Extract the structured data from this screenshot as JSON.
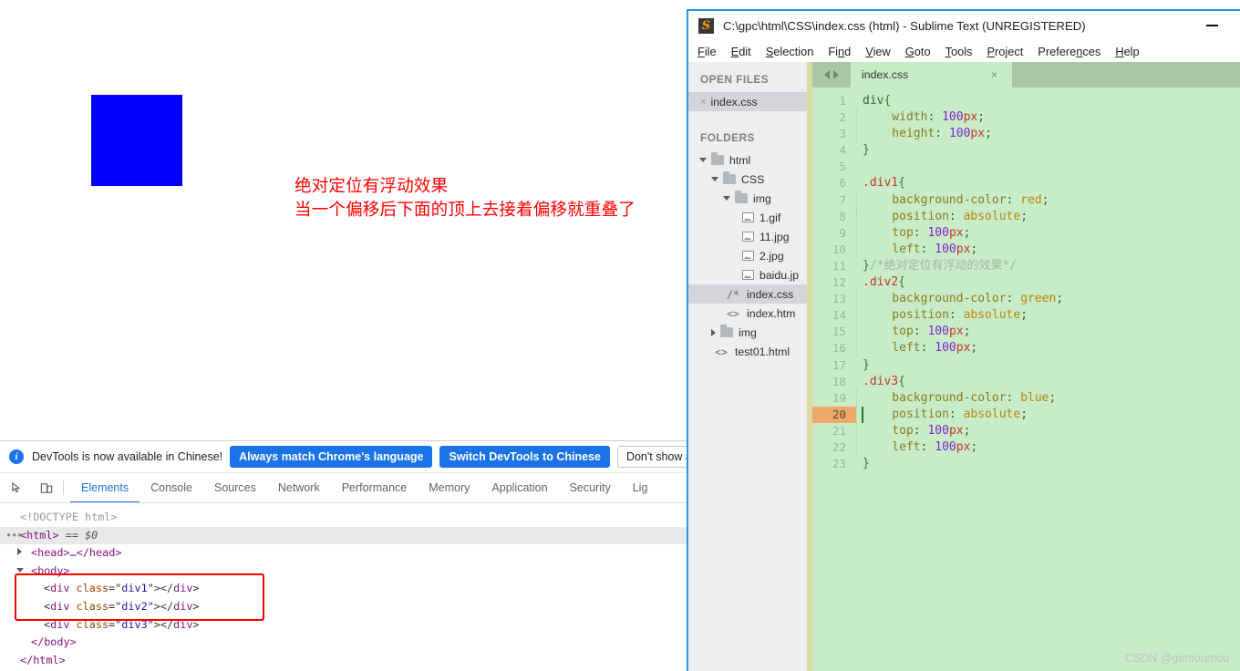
{
  "browser": {
    "blue_box_color": "#0000ff",
    "annotation": {
      "color": "#ff0000",
      "line1": "绝对定位有浮动效果",
      "line2": "当一个偏移后下面的顶上去接着偏移就重叠了"
    }
  },
  "devtools": {
    "notice": {
      "icon": "info-icon",
      "text": "DevTools is now available in Chinese!",
      "btn_always": "Always match Chrome's language",
      "btn_switch": "Switch DevTools to Chinese",
      "btn_dismiss": "Don't show again"
    },
    "toolbar": {
      "inspect_icon": "inspect-cursor-icon",
      "device_icon": "device-toolbar-icon"
    },
    "tabs": [
      {
        "label": "Elements",
        "active": true
      },
      {
        "label": "Console",
        "active": false
      },
      {
        "label": "Sources",
        "active": false
      },
      {
        "label": "Network",
        "active": false
      },
      {
        "label": "Performance",
        "active": false
      },
      {
        "label": "Memory",
        "active": false
      },
      {
        "label": "Application",
        "active": false
      },
      {
        "label": "Security",
        "active": false
      },
      {
        "label": "Lig",
        "active": false
      }
    ],
    "dom": {
      "doctype": "<!DOCTYPE html>",
      "html_open_tag": "<html>",
      "selected_marker": "== $0",
      "head_line": "<head>…</head>",
      "body_open": "<body>",
      "div1": {
        "tag": "div",
        "attr": "class",
        "value": "div1"
      },
      "div2": {
        "tag": "div",
        "attr": "class",
        "value": "div2"
      },
      "div3": {
        "tag": "div",
        "attr": "class",
        "value": "div3"
      },
      "body_close": "</body>",
      "html_close": "</html>",
      "highlight_color": "#ff0000"
    }
  },
  "sublime": {
    "titlebar": {
      "logo": "sublime-text-logo",
      "title": "C:\\gpc\\html\\CSS\\index.css (html) - Sublime Text (UNREGISTERED)",
      "minimize": "minimize-icon"
    },
    "menu": [
      {
        "label": "File",
        "mnemonic": "F"
      },
      {
        "label": "Edit",
        "mnemonic": "E"
      },
      {
        "label": "Selection",
        "mnemonic": "S"
      },
      {
        "label": "Find",
        "mnemonic": "n"
      },
      {
        "label": "View",
        "mnemonic": "V"
      },
      {
        "label": "Goto",
        "mnemonic": "G"
      },
      {
        "label": "Tools",
        "mnemonic": "T"
      },
      {
        "label": "Project",
        "mnemonic": "P"
      },
      {
        "label": "Preferences",
        "mnemonic": "n"
      },
      {
        "label": "Help",
        "mnemonic": "H"
      }
    ],
    "sidebar": {
      "open_files_heading": "OPEN FILES",
      "open_files": [
        {
          "label": "index.css",
          "selected": true
        }
      ],
      "folders_heading": "FOLDERS",
      "tree": [
        {
          "label": "html",
          "depth": 0,
          "icon": "folder-open-icon",
          "twisty": "down",
          "selected": false
        },
        {
          "label": "CSS",
          "depth": 1,
          "icon": "folder-open-icon",
          "twisty": "down",
          "selected": false
        },
        {
          "label": "img",
          "depth": 2,
          "icon": "folder-open-icon",
          "twisty": "down",
          "selected": false
        },
        {
          "label": "1.gif",
          "depth": 3,
          "icon": "image-file-icon",
          "twisty": "none",
          "selected": false
        },
        {
          "label": "11.jpg",
          "depth": 3,
          "icon": "image-file-icon",
          "twisty": "none",
          "selected": false
        },
        {
          "label": "2.jpg",
          "depth": 3,
          "icon": "image-file-icon",
          "twisty": "none",
          "selected": false
        },
        {
          "label": "baidu.jp",
          "depth": 3,
          "icon": "image-file-icon",
          "twisty": "none",
          "selected": false
        },
        {
          "label": "index.css",
          "depth": 2,
          "icon": "css-file-icon",
          "twisty": "none",
          "selected": true
        },
        {
          "label": "index.htm",
          "depth": 2,
          "icon": "html-file-icon",
          "twisty": "none",
          "selected": false
        },
        {
          "label": "img",
          "depth": 1,
          "icon": "folder-icon",
          "twisty": "right",
          "selected": false
        },
        {
          "label": "test01.html",
          "depth": 1,
          "icon": "html-file-icon",
          "twisty": "none",
          "selected": false
        }
      ]
    },
    "tabbar": {
      "nav_prev": "nav-prev-icon",
      "nav_next": "nav-next-icon",
      "tabs": [
        {
          "label": "index.css",
          "close": "×",
          "active": true
        }
      ]
    },
    "editor": {
      "current_line": 20,
      "lines": [
        {
          "n": 1,
          "text": "div{"
        },
        {
          "n": 2,
          "text": "    width: 100px;"
        },
        {
          "n": 3,
          "text": "    height: 100px;"
        },
        {
          "n": 4,
          "text": "}"
        },
        {
          "n": 5,
          "text": ""
        },
        {
          "n": 6,
          "text": ".div1{"
        },
        {
          "n": 7,
          "text": "    background-color: red;"
        },
        {
          "n": 8,
          "text": "    position: absolute;"
        },
        {
          "n": 9,
          "text": "    top: 100px;"
        },
        {
          "n": 10,
          "text": "    left: 100px;"
        },
        {
          "n": 11,
          "text": "}/*绝对定位有浮动的效果*/"
        },
        {
          "n": 12,
          "text": ".div2{"
        },
        {
          "n": 13,
          "text": "    background-color: green;"
        },
        {
          "n": 14,
          "text": "    position: absolute;"
        },
        {
          "n": 15,
          "text": "    top: 100px;"
        },
        {
          "n": 16,
          "text": "    left: 100px;"
        },
        {
          "n": 17,
          "text": "}"
        },
        {
          "n": 18,
          "text": ".div3{"
        },
        {
          "n": 19,
          "text": "    background-color: blue;"
        },
        {
          "n": 20,
          "text": "    position: absolute;"
        },
        {
          "n": 21,
          "text": "    top: 100px;"
        },
        {
          "n": 22,
          "text": "    left: 100px;"
        },
        {
          "n": 23,
          "text": "}"
        }
      ]
    },
    "watermark": "CSDN @gemoumou"
  }
}
